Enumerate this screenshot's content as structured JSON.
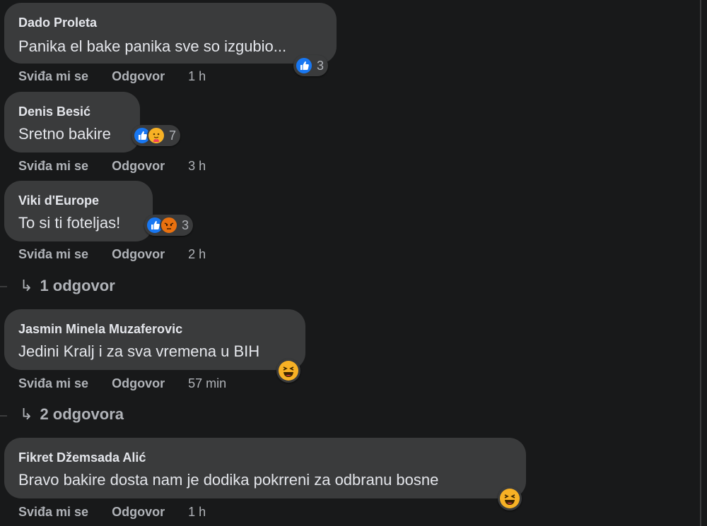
{
  "actions": {
    "like_label": "Sviđa mi se",
    "reply_label": "Odgovor"
  },
  "comments": [
    {
      "author": "Dado Proleta",
      "text": "Panika el bake panika sve so izgubio...",
      "time": "1 h",
      "reaction_count": "3",
      "reactions": [
        "like-icon"
      ]
    },
    {
      "author": "Denis Besić",
      "text": "Sretno bakire",
      "time": "3 h",
      "reaction_count": "7",
      "reactions": [
        "like-icon",
        "care-icon"
      ]
    },
    {
      "author": "Viki d'Europe",
      "text": "To si ti foteljas!",
      "time": "2 h",
      "reaction_count": "3",
      "reactions": [
        "like-icon",
        "angry-icon"
      ]
    },
    {
      "author": "Jasmin Minela Muzaferovic",
      "text": "Jedini Kralj i za sva vremena u BIH",
      "time": "57 min",
      "reactions": [
        "haha-icon"
      ]
    },
    {
      "author": "Fikret Džemsada Alić",
      "text": "Bravo bakire dosta nam je dodika pokrreni za odbranu bosne",
      "time": "1 h",
      "reactions": [
        "haha-icon"
      ]
    }
  ],
  "replies": [
    {
      "arrow": "↳",
      "label": "1 odgovor"
    },
    {
      "arrow": "↳",
      "label": "2 odgovora"
    }
  ],
  "colors": {
    "background": "#18191a",
    "bubble": "#3a3b3c",
    "like_blue": "#1877f2",
    "secondary_text": "#b0b3b8"
  }
}
